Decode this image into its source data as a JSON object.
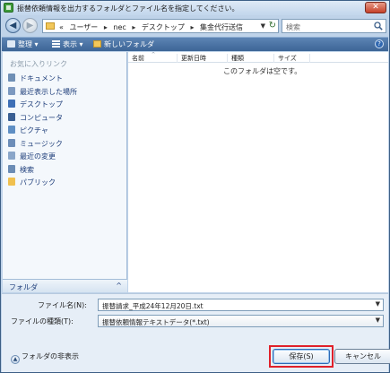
{
  "window": {
    "title": "振替依頼情報を出力するフォルダとファイル名を指定してください。",
    "close_glyph": "✕"
  },
  "address_bar": {
    "crumbs": [
      "«",
      "ユーザー",
      "nec",
      "デスクトップ",
      "集金代行送信"
    ],
    "separator": "▸",
    "search_placeholder": "検索"
  },
  "toolbar": {
    "organize": "整理",
    "views": "表示",
    "new_folder": "新しいフォルダ",
    "help": "?"
  },
  "sidebar": {
    "heading": "お気に入りリンク",
    "items": [
      {
        "label": "ドキュメント",
        "icon": "documents-icon",
        "color": "#6f8fb5"
      },
      {
        "label": "最近表示した場所",
        "icon": "recent-places-icon",
        "color": "#7c99c0"
      },
      {
        "label": "デスクトップ",
        "icon": "desktop-icon",
        "color": "#3e6fb6"
      },
      {
        "label": "コンピュータ",
        "icon": "computer-icon",
        "color": "#3a5f93"
      },
      {
        "label": "ピクチャ",
        "icon": "pictures-icon",
        "color": "#5f8fc4"
      },
      {
        "label": "ミュージック",
        "icon": "music-icon",
        "color": "#6c8db8"
      },
      {
        "label": "最近の変更",
        "icon": "recent-changes-icon",
        "color": "#8aa6c9"
      },
      {
        "label": "検索",
        "icon": "search-folder-icon",
        "color": "#6b8cb5"
      },
      {
        "label": "パブリック",
        "icon": "public-folder-icon",
        "color": "#f0c04f"
      }
    ],
    "folders_label": "フォルダ",
    "folders_caret": "^"
  },
  "file_list": {
    "columns": [
      "名前",
      "更新日時",
      "種類",
      "サイズ"
    ],
    "empty_message": "このフォルダは空です。"
  },
  "form": {
    "filename_label": "ファイル名(N):",
    "filename_value": "振替請求_平成24年12月20日.txt",
    "filetype_label": "ファイルの種類(T):",
    "filetype_value": "振替依頼情報テキストデータ(*.txt)",
    "hide_folders": "フォルダの非表示",
    "save_button": "保存(S)",
    "cancel_button": "キャンセル"
  },
  "colors": {
    "toolbar": "#4a72a5",
    "highlight": "#e0202a"
  }
}
